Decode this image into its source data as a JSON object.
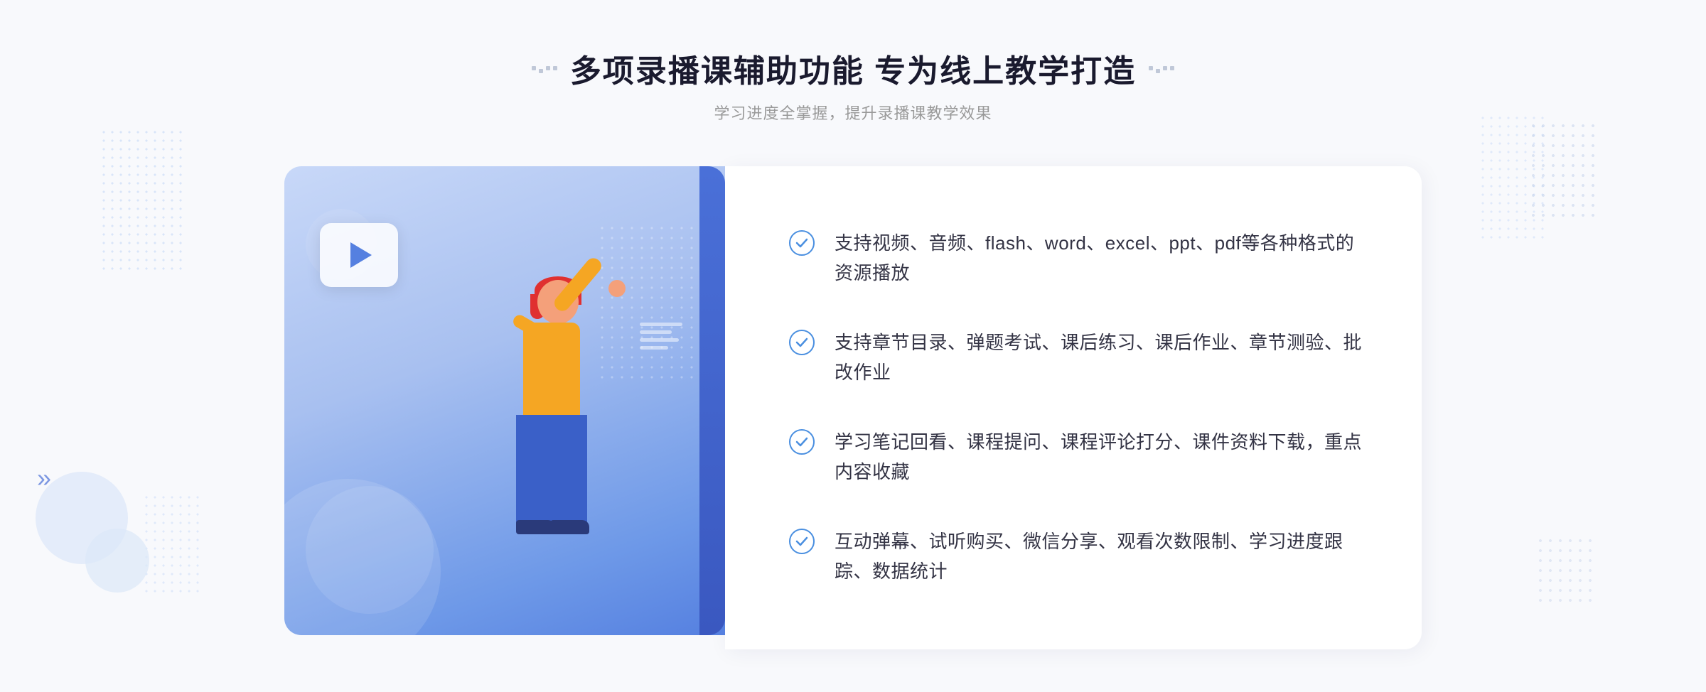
{
  "header": {
    "title": "多项录播课辅助功能 专为线上教学打造",
    "subtitle": "学习进度全掌握，提升录播课教学效果",
    "decorator_dots": [
      "·",
      "·",
      "·",
      "·"
    ]
  },
  "features": [
    {
      "id": 1,
      "text": "支持视频、音频、flash、word、excel、ppt、pdf等各种格式的资源播放"
    },
    {
      "id": 2,
      "text": "支持章节目录、弹题考试、课后练习、课后作业、章节测验、批改作业"
    },
    {
      "id": 3,
      "text": "学习笔记回看、课程提问、课程评论打分、课件资料下载，重点内容收藏"
    },
    {
      "id": 4,
      "text": "互动弹幕、试听购买、微信分享、观看次数限制、学习进度跟踪、数据统计"
    }
  ],
  "colors": {
    "primary_blue": "#4a70d8",
    "light_blue": "#a8c0f0",
    "accent": "#5580e0",
    "text_dark": "#1a1a2e",
    "text_gray": "#999999",
    "check_blue": "#4a8fe0"
  }
}
